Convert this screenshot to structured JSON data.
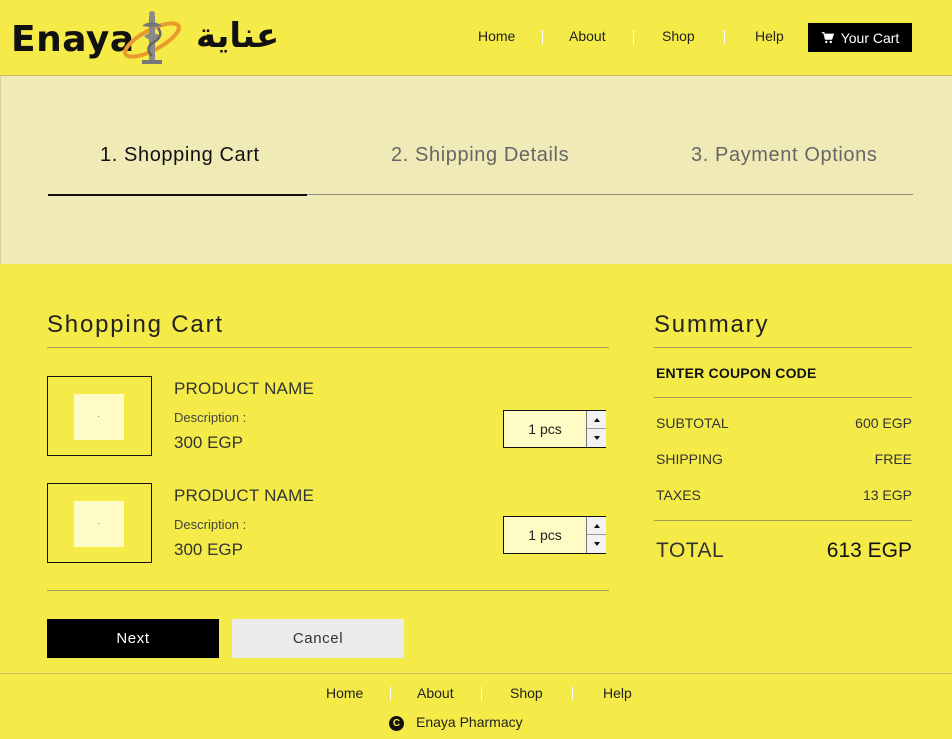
{
  "header": {
    "brand": "Enaya",
    "brand_arabic": "عناية",
    "nav": [
      "Home",
      "About",
      "Shop",
      "Help"
    ],
    "cart_label": "Your Cart"
  },
  "steps": [
    {
      "label": "1. Shopping Cart",
      "active": true
    },
    {
      "label": "2. Shipping Details",
      "active": false
    },
    {
      "label": "3. Payment Options",
      "active": false
    }
  ],
  "cart": {
    "title": "Shopping Cart",
    "items": [
      {
        "name": "PRODUCT NAME",
        "description": "Description :",
        "price": "300 EGP",
        "quantity": "1 pcs"
      },
      {
        "name": "PRODUCT NAME",
        "description": "Description :",
        "price": "300 EGP",
        "quantity": "1 pcs"
      }
    ],
    "next_label": "Next",
    "cancel_label": "Cancel"
  },
  "summary": {
    "title": "Summary",
    "coupon_label": "ENTER COUPON CODE",
    "rows": [
      {
        "label": "SUBTOTAL",
        "value": "600 EGP"
      },
      {
        "label": "SHIPPING",
        "value": "FREE"
      },
      {
        "label": "TAXES",
        "value": "13 EGP"
      }
    ],
    "total_label": "TOTAL",
    "total_value": "613 EGP"
  },
  "footer": {
    "nav": [
      "Home",
      "About",
      "Shop",
      "Help"
    ],
    "copyright_symbol": "C",
    "copyright_text": "Enaya Pharmacy"
  },
  "colors": {
    "background": "#f4eb48",
    "panel": "#f0ebb6",
    "product_placeholder": "#fffbc5",
    "primary_button": "#000000",
    "secondary_button": "#ebebeb"
  }
}
